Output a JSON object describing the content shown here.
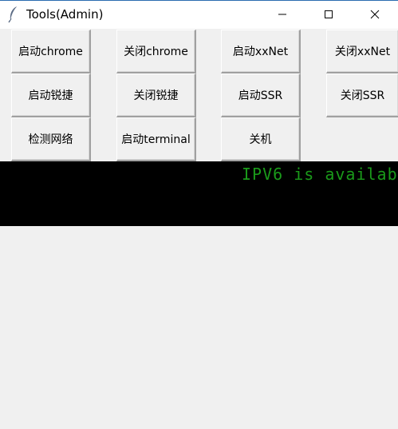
{
  "window": {
    "title": "Tools(Admin)",
    "app_icon": "feather-icon",
    "controls": {
      "minimize_icon": "minimize-icon",
      "maximize_icon": "maximize-icon",
      "close_icon": "close-icon"
    }
  },
  "buttons": {
    "start_chrome": "启动chrome",
    "close_chrome": "关闭chrome",
    "start_xxnet": "启动xxNet",
    "close_xxnet": "关闭xxNet",
    "start_ruijie": "启动锐捷",
    "close_ruijie": "关闭锐捷",
    "start_ssr": "启动SSR",
    "close_ssr": "关闭SSR",
    "check_network": "检测网络",
    "start_terminal": "启动terminal",
    "shutdown": "关机"
  },
  "console": {
    "message": "IPV6 is availab",
    "text_color": "#1a9a1a",
    "background": "#000000"
  }
}
